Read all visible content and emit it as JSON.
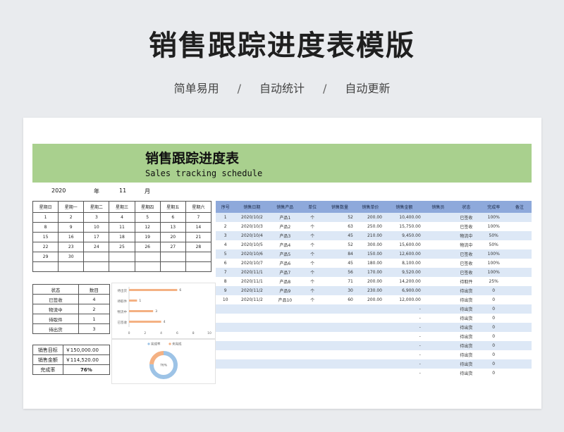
{
  "header": {
    "title": "销售跟踪进度表模版",
    "tags": [
      "简单易用",
      "自动统计",
      "自动更新"
    ],
    "separator": "/"
  },
  "sheet": {
    "title_cn": "销售跟踪进度表",
    "title_en": "Sales tracking schedule",
    "year": "2020",
    "year_label": "年",
    "month": "11",
    "month_label": "月"
  },
  "calendar": {
    "headers": [
      "星期日",
      "星期一",
      "星期二",
      "星期三",
      "星期四",
      "星期五",
      "星期六"
    ],
    "rows": [
      [
        "1",
        "2",
        "3",
        "4",
        "5",
        "6",
        "7"
      ],
      [
        "8",
        "9",
        "10",
        "11",
        "12",
        "13",
        "14"
      ],
      [
        "15",
        "16",
        "17",
        "18",
        "19",
        "20",
        "21"
      ],
      [
        "22",
        "23",
        "24",
        "25",
        "26",
        "27",
        "28"
      ],
      [
        "29",
        "30",
        "",
        "",
        "",
        "",
        ""
      ],
      [
        "",
        "",
        "",
        "",
        "",
        "",
        ""
      ]
    ]
  },
  "status_table": {
    "headers": [
      "状态",
      "数目"
    ],
    "rows": [
      [
        "已签收",
        "4"
      ],
      [
        "物流中",
        "2"
      ],
      [
        "待取件",
        "1"
      ],
      [
        "待出货",
        "3"
      ]
    ]
  },
  "kpi": {
    "rows": [
      [
        "销售目标",
        "￥150,000.00"
      ],
      [
        "销售金额",
        "￥114,520.00"
      ],
      [
        "完成率",
        "76%"
      ]
    ]
  },
  "chart_data": [
    {
      "type": "bar",
      "orientation": "horizontal",
      "categories": [
        "待出货",
        "待取件",
        "物流中",
        "已签收"
      ],
      "values": [
        6,
        1,
        3,
        4
      ],
      "value_labels": [
        "6",
        "1",
        "3",
        "4"
      ],
      "xlim": [
        0,
        10
      ],
      "xticks": [
        "0",
        "2",
        "4",
        "6",
        "8",
        "10"
      ],
      "color": "#f4b183"
    },
    {
      "type": "pie",
      "legend": [
        "完成率",
        "未完成"
      ],
      "values": [
        76,
        24
      ],
      "center_label": "76%",
      "colors": [
        "#9dc3e6",
        "#f4b183"
      ]
    }
  ],
  "sales": {
    "headers": [
      "序号",
      "销售日期",
      "销售产品",
      "单位",
      "销售数量",
      "销售单价",
      "销售金额",
      "销售员",
      "状态",
      "完成率",
      "备注"
    ],
    "rows": [
      [
        "1",
        "2020/10/2",
        "产品1",
        "个",
        "52",
        "200.00",
        "10,400.00",
        "",
        "已签收",
        "100%",
        ""
      ],
      [
        "2",
        "2020/10/3",
        "产品2",
        "个",
        "63",
        "250.00",
        "15,750.00",
        "",
        "已签收",
        "100%",
        ""
      ],
      [
        "3",
        "2020/10/4",
        "产品3",
        "个",
        "45",
        "210.00",
        "9,450.00",
        "",
        "物流中",
        "50%",
        ""
      ],
      [
        "4",
        "2020/10/5",
        "产品4",
        "个",
        "52",
        "300.00",
        "15,600.00",
        "",
        "物流中",
        "50%",
        ""
      ],
      [
        "5",
        "2020/10/6",
        "产品5",
        "个",
        "84",
        "150.00",
        "12,600.00",
        "",
        "已签收",
        "100%",
        ""
      ],
      [
        "6",
        "2020/10/7",
        "产品6",
        "个",
        "45",
        "180.00",
        "8,100.00",
        "",
        "已签收",
        "100%",
        ""
      ],
      [
        "7",
        "2020/11/1",
        "产品7",
        "个",
        "56",
        "170.00",
        "9,520.00",
        "",
        "已签收",
        "100%",
        ""
      ],
      [
        "8",
        "2020/11/1",
        "产品8",
        "个",
        "71",
        "200.00",
        "14,200.00",
        "",
        "待取件",
        "25%",
        ""
      ],
      [
        "9",
        "2020/11/2",
        "产品9",
        "个",
        "30",
        "230.00",
        "6,900.00",
        "",
        "待出货",
        "0",
        ""
      ],
      [
        "10",
        "2020/11/2",
        "产品10",
        "个",
        "60",
        "200.00",
        "12,000.00",
        "",
        "待出货",
        "0",
        ""
      ],
      [
        "",
        "",
        "",
        "",
        "",
        "",
        "-",
        "",
        "待出货",
        "0",
        ""
      ],
      [
        "",
        "",
        "",
        "",
        "",
        "",
        "-",
        "",
        "待出货",
        "0",
        ""
      ],
      [
        "",
        "",
        "",
        "",
        "",
        "",
        "-",
        "",
        "待出货",
        "0",
        ""
      ],
      [
        "",
        "",
        "",
        "",
        "",
        "",
        "-",
        "",
        "待出货",
        "0",
        ""
      ],
      [
        "",
        "",
        "",
        "",
        "",
        "",
        "-",
        "",
        "待出货",
        "0",
        ""
      ],
      [
        "",
        "",
        "",
        "",
        "",
        "",
        "-",
        "",
        "待出货",
        "0",
        ""
      ],
      [
        "",
        "",
        "",
        "",
        "",
        "",
        "-",
        "",
        "待出货",
        "0",
        ""
      ],
      [
        "",
        "",
        "",
        "",
        "",
        "",
        "-",
        "",
        "待出货",
        "0",
        ""
      ]
    ]
  }
}
